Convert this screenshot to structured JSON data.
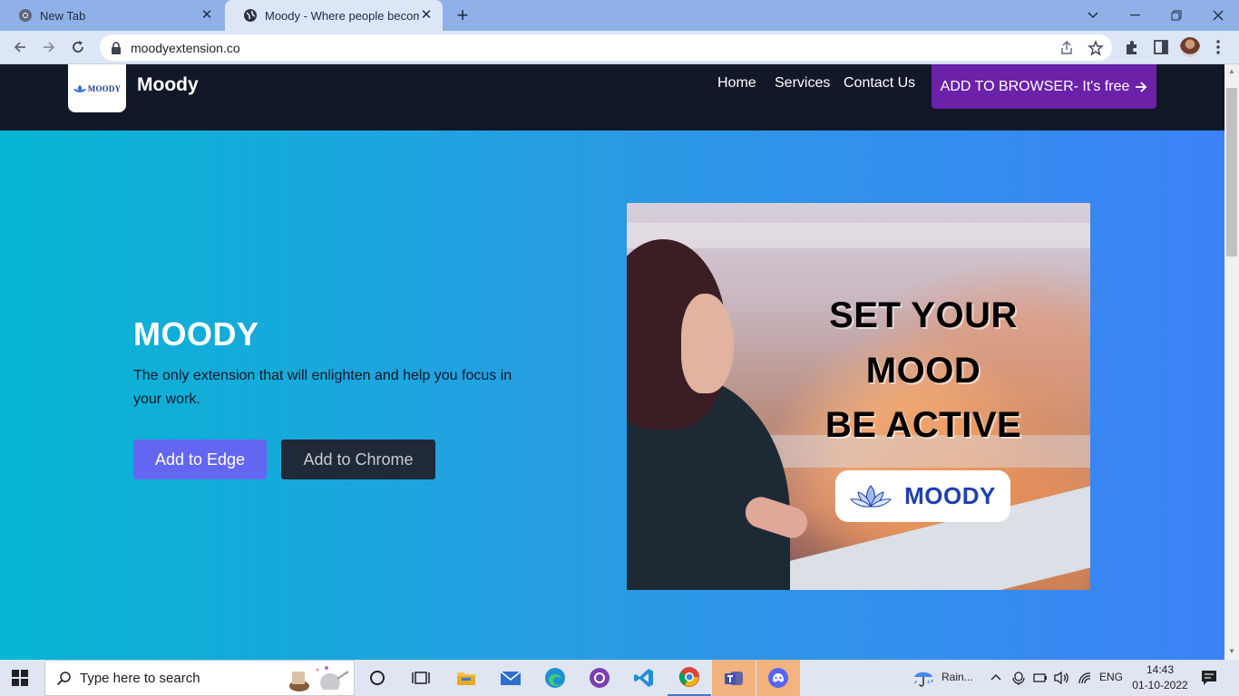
{
  "browser": {
    "tabs": [
      {
        "title": "New Tab"
      },
      {
        "title": "Moody - Where people become"
      }
    ],
    "url": "moodyextension.co"
  },
  "site": {
    "brand": "Moody",
    "logo_text": "MOODY",
    "nav": [
      "Home",
      "Services",
      "Contact Us"
    ],
    "cta": "ADD TO BROWSER- It's free"
  },
  "hero": {
    "title": "MOODY",
    "description": "The only extension that will enlighten and help you focus in your work.",
    "btn_edge": "Add to Edge",
    "btn_chrome": "Add to Chrome"
  },
  "promo": {
    "line1": "SET YOUR",
    "line2": "MOOD",
    "line3": "BE ACTIVE",
    "badge": "MOODY"
  },
  "taskbar": {
    "search_placeholder": "Type here to search",
    "weather": "Rain...",
    "language": "ENG",
    "time": "14:43",
    "date": "01-10-2022"
  },
  "colors": {
    "nav_bg": "#111827",
    "cta_bg": "#6b21a8",
    "hero_start": "#06b6d4",
    "hero_end": "#3b82f6",
    "btn_edge": "#6366f1",
    "btn_chrome": "#1f2937",
    "badge_text": "#1e40af"
  }
}
